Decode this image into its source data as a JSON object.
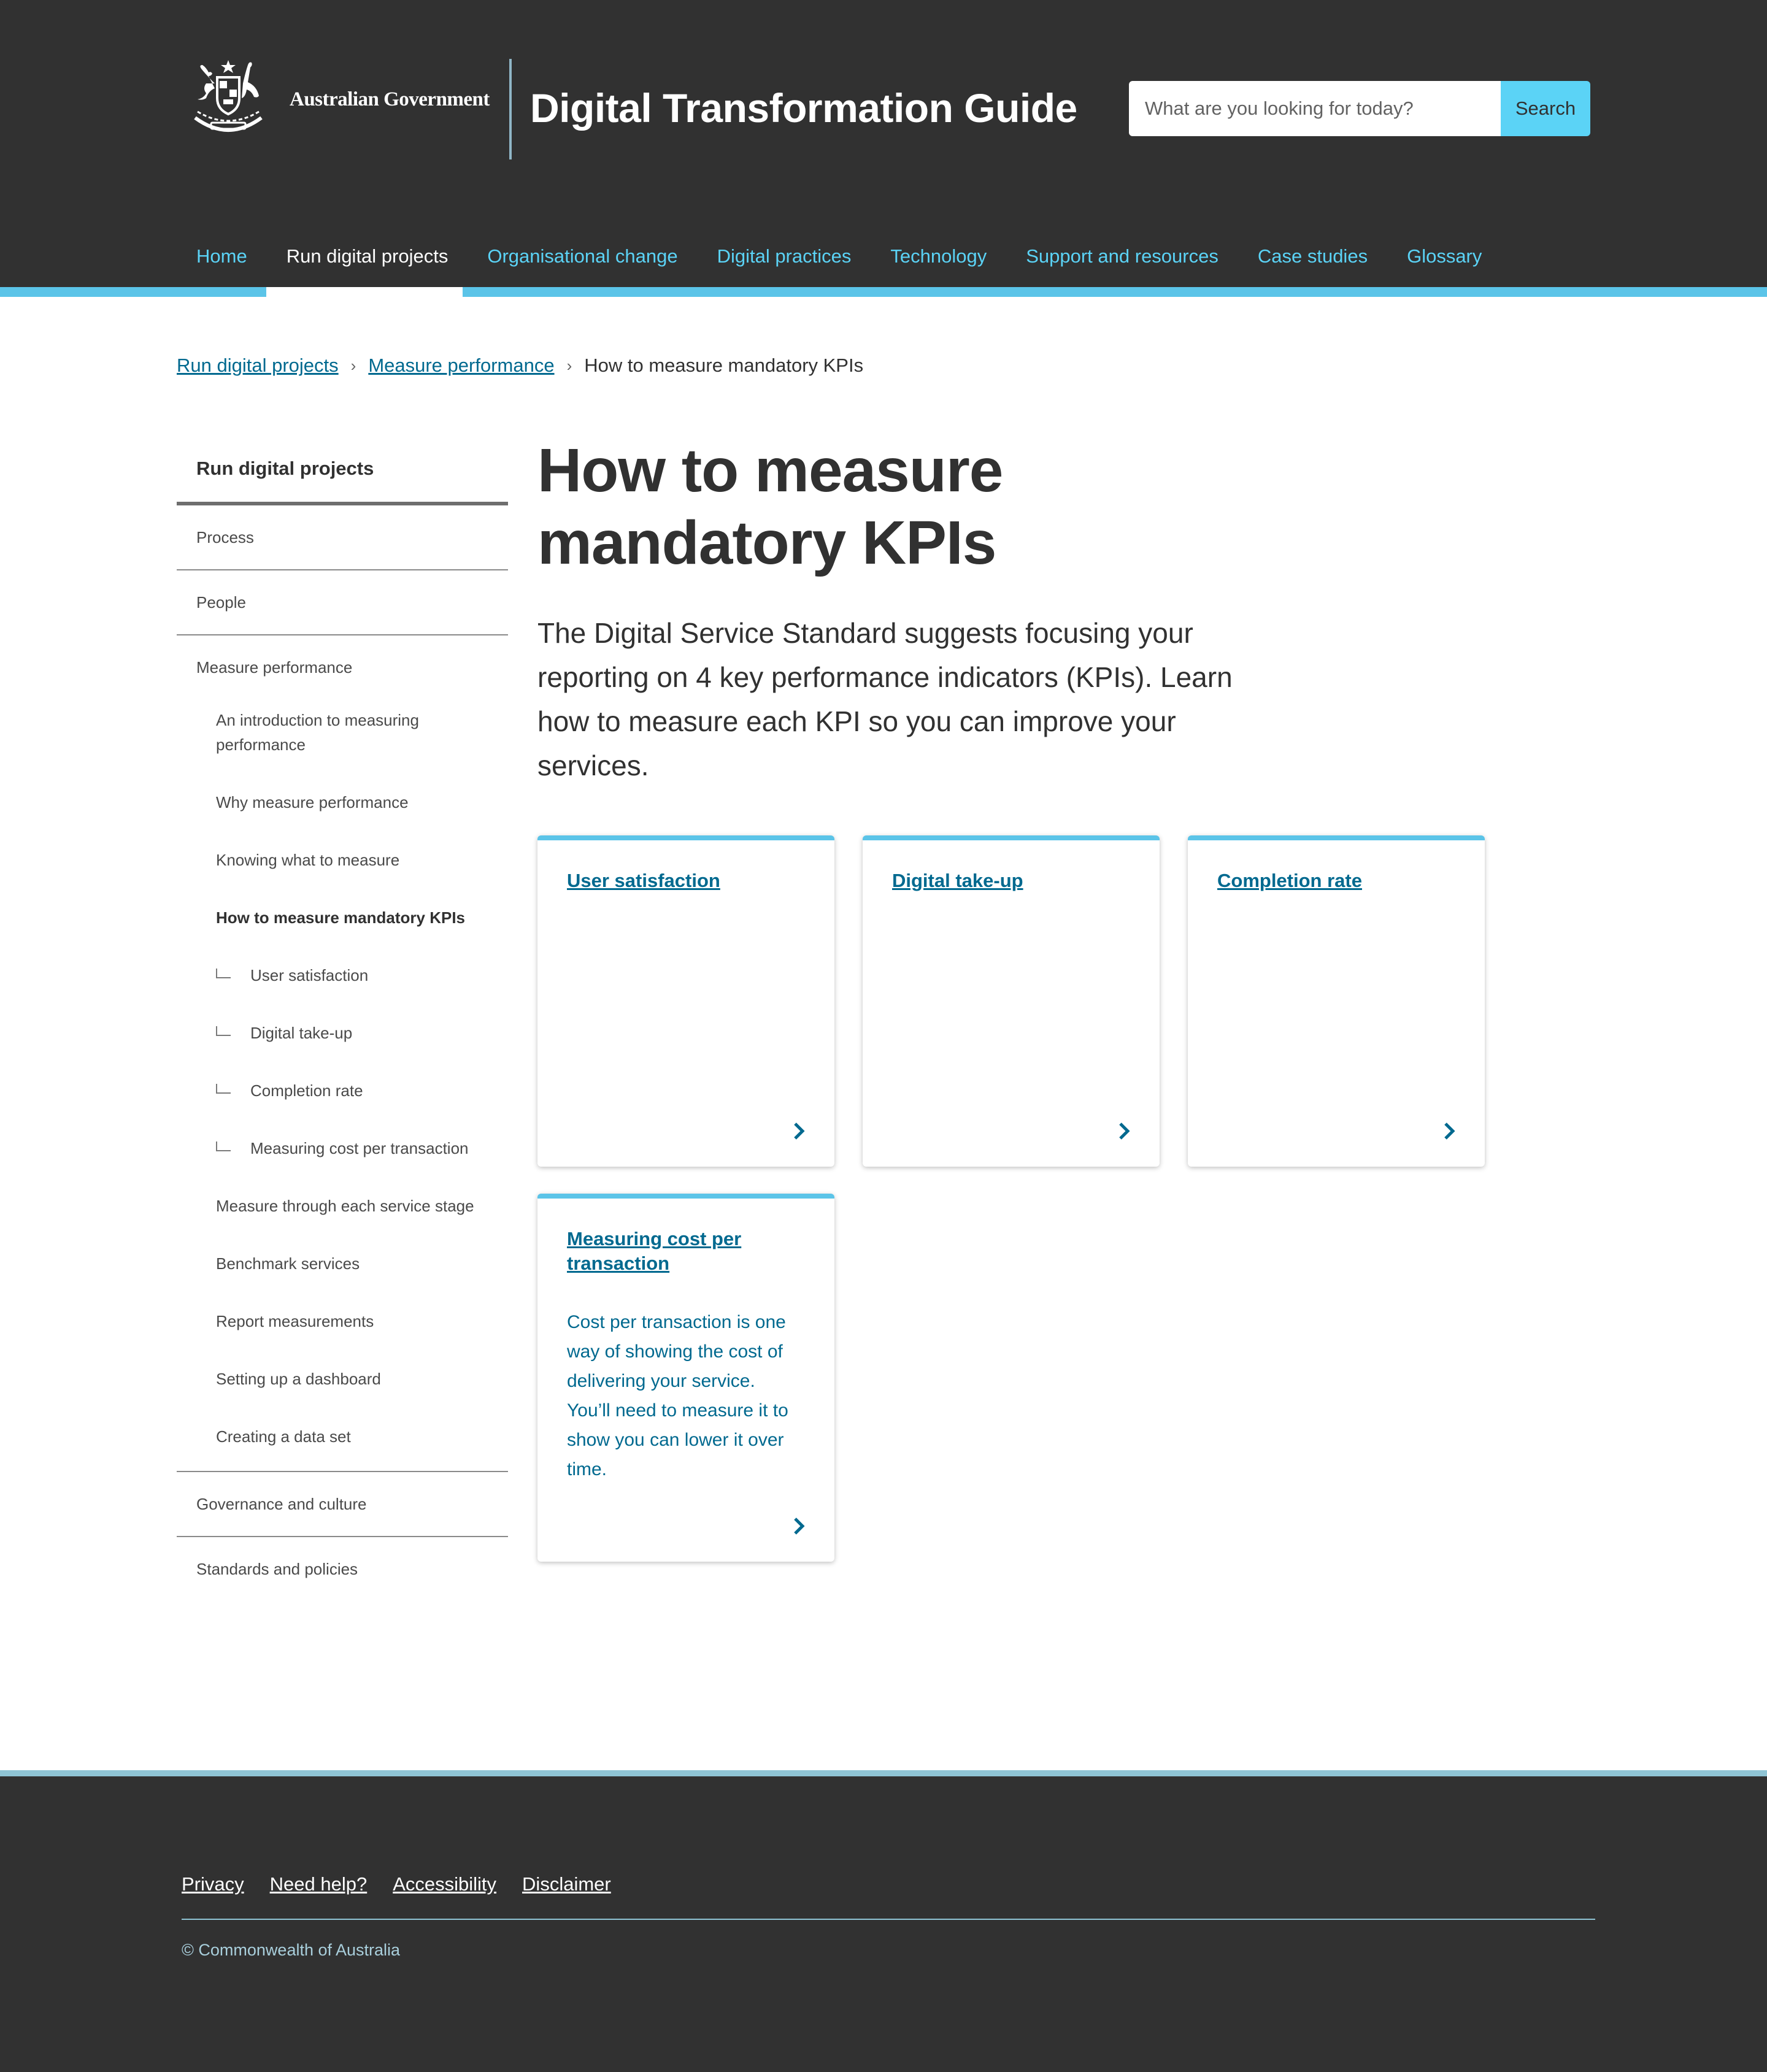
{
  "header": {
    "gov_name": "Australian Government",
    "site_title": "Digital Transformation Guide",
    "search": {
      "placeholder": "What are you looking for today?",
      "button_label": "Search"
    }
  },
  "nav": {
    "items": [
      {
        "label": "Home"
      },
      {
        "label": "Run digital projects",
        "active": true
      },
      {
        "label": "Organisational change"
      },
      {
        "label": "Digital practices"
      },
      {
        "label": "Technology"
      },
      {
        "label": "Support and resources"
      },
      {
        "label": "Case studies"
      },
      {
        "label": "Glossary"
      }
    ]
  },
  "breadcrumb": {
    "items": [
      "Run digital projects",
      "Measure performance"
    ],
    "current": "How to measure mandatory KPIs"
  },
  "sidebar": {
    "heading": "Run digital projects",
    "items": {
      "process": "Process",
      "people": "People",
      "measure": "Measure performance",
      "sub": {
        "intro": "An introduction to measuring performance",
        "why": "Why measure performance",
        "knowing": "Knowing what to measure",
        "how": "How to measure mandatory KPIs",
        "user_sat": "User satisfaction",
        "digital_takeup": "Digital take-up",
        "completion": "Completion rate",
        "cost": "Measuring cost per transaction",
        "stage": "Measure through each service stage",
        "benchmark": "Benchmark services",
        "report": "Report measurements",
        "dashboard": "Setting up a dashboard",
        "dataset": "Creating a data set"
      },
      "governance": "Governance and culture",
      "standards": "Standards and policies"
    }
  },
  "main": {
    "title": "How to measure mandatory KPIs",
    "intro": "The Digital Service Standard suggests  focusing your reporting on 4 key performance indicators (KPIs). Learn how to measure each KPI so you can improve your services.",
    "cards": [
      {
        "title": "User satisfaction",
        "text": ""
      },
      {
        "title": "Digital take-up",
        "text": ""
      },
      {
        "title": "Completion rate",
        "text": ""
      },
      {
        "title": "Measuring cost per transaction",
        "text": "Cost per transaction is one way of showing the cost of delivering your service. You’ll need to measure it to show you can lower it over time."
      }
    ]
  },
  "footer": {
    "links": [
      "Privacy",
      "Need help?",
      "Accessibility",
      "Disclaimer"
    ],
    "copyright": "© Commonwealth of Australia"
  },
  "colors": {
    "header_bg": "#313131",
    "accent": "#5bc4e8",
    "nav_link": "#5bd3f6",
    "link": "#00698f"
  },
  "icons": [
    "coat-of-arms-icon",
    "breadcrumb-chevron-icon",
    "branch-icon",
    "chevron-right-icon"
  ]
}
